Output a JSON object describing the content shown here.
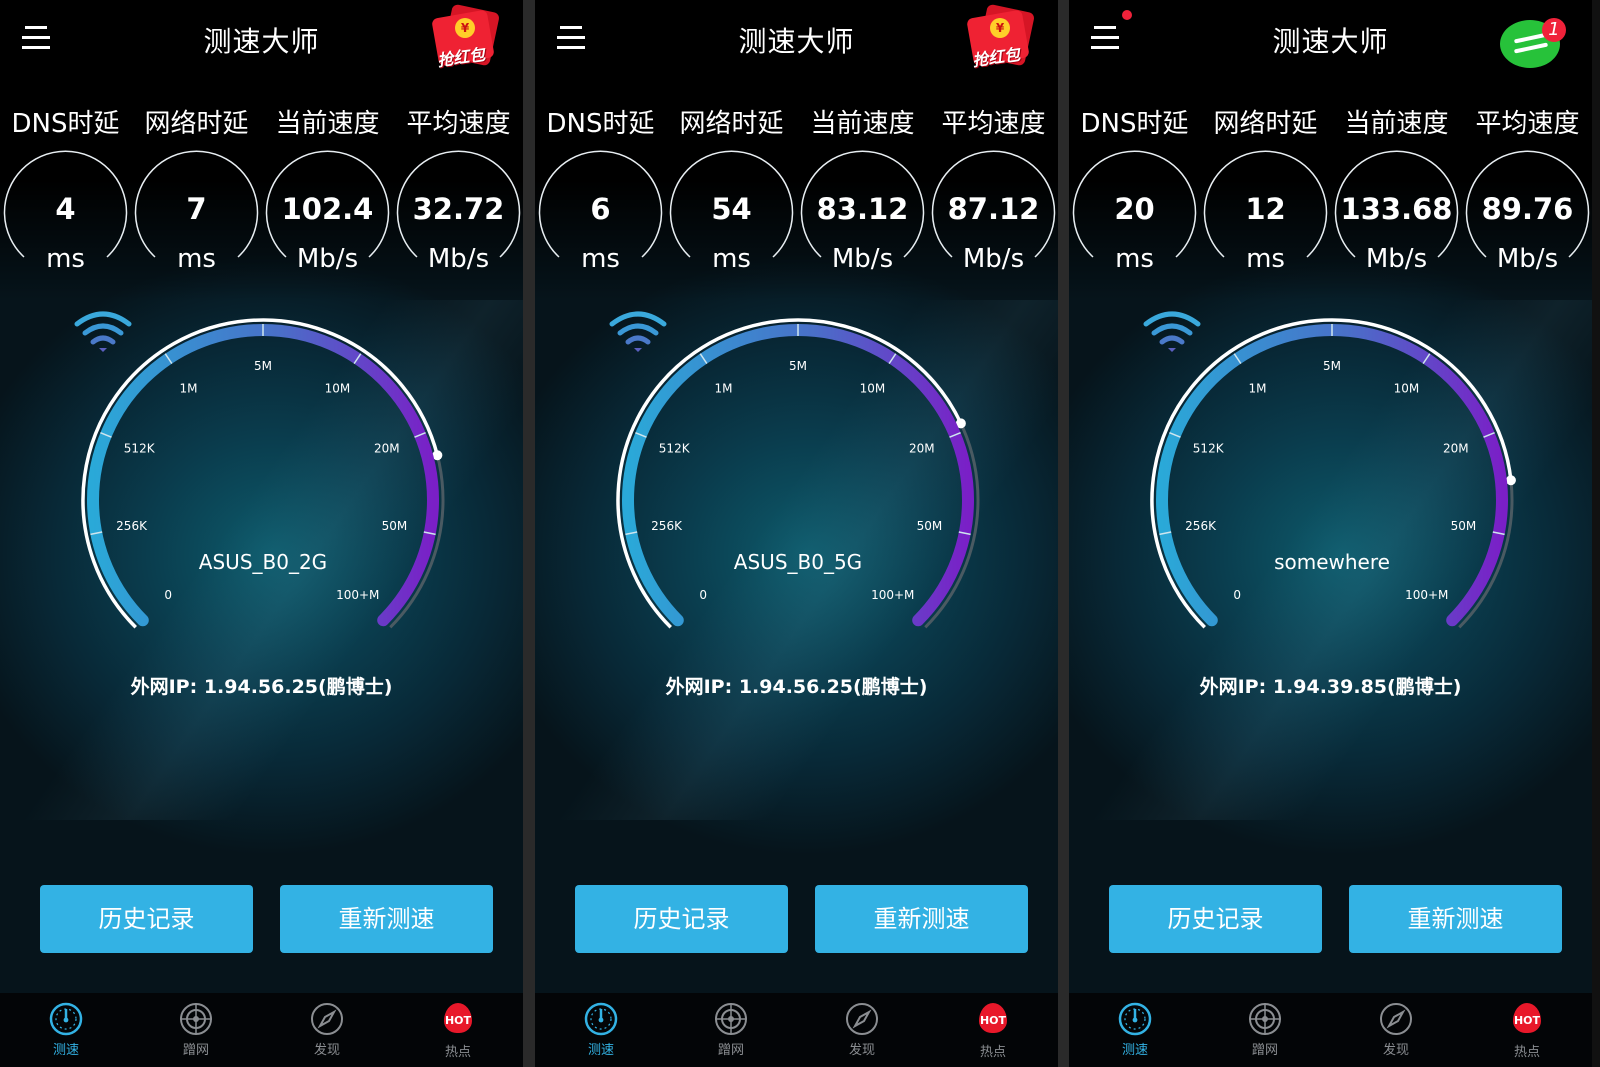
{
  "app_title": "测速大师",
  "redpacket_label": "抢红包",
  "redpacket_coin": "¥",
  "wechat_badge": "1",
  "metric_labels": [
    "DNS时延",
    "网络时延",
    "当前速度",
    "平均速度"
  ],
  "gauge_ticks": [
    "0",
    "256K",
    "512K",
    "1M",
    "5M",
    "10M",
    "20M",
    "50M",
    "100+M"
  ],
  "ip_prefix": "外网IP: ",
  "buttons": {
    "history": "历史记录",
    "retest": "重新测速"
  },
  "nav": [
    {
      "label": "测速",
      "icon": "speedometer-icon",
      "active": true
    },
    {
      "label": "蹭网",
      "icon": "radar-icon",
      "active": false
    },
    {
      "label": "发现",
      "icon": "compass-icon",
      "active": false
    },
    {
      "label": "热点",
      "icon": "hot-flame-icon",
      "badge": "HOT",
      "active": false
    }
  ],
  "colors": {
    "accent": "#33b2e4",
    "gauge_start": "#2aa9d8",
    "gauge_end": "#7a1fc7",
    "badge_red": "#f0223a"
  },
  "screens": [
    {
      "top_right": "redpacket",
      "notification_dot": false,
      "metrics": [
        {
          "value": "4",
          "unit": "ms"
        },
        {
          "value": "7",
          "unit": "ms"
        },
        {
          "value": "102.4",
          "unit": "Mb/s"
        },
        {
          "value": "32.72",
          "unit": "Mb/s"
        }
      ],
      "ssid": "ASUS_B0_2G",
      "gauge_level": 0.78,
      "ip": "1.94.56.25(鹏博士)"
    },
    {
      "top_right": "redpacket",
      "notification_dot": false,
      "metrics": [
        {
          "value": "6",
          "unit": "ms"
        },
        {
          "value": "54",
          "unit": "ms"
        },
        {
          "value": "83.12",
          "unit": "Mb/s"
        },
        {
          "value": "87.12",
          "unit": "Mb/s"
        }
      ],
      "ssid": "ASUS_B0_5G",
      "gauge_level": 0.74,
      "ip": "1.94.56.25(鹏博士)"
    },
    {
      "top_right": "wechat",
      "notification_dot": true,
      "metrics": [
        {
          "value": "20",
          "unit": "ms"
        },
        {
          "value": "12",
          "unit": "ms"
        },
        {
          "value": "133.68",
          "unit": "Mb/s"
        },
        {
          "value": "89.76",
          "unit": "Mb/s"
        }
      ],
      "ssid": "somewhere",
      "gauge_level": 0.81,
      "ip": "1.94.39.85(鹏博士)"
    }
  ]
}
